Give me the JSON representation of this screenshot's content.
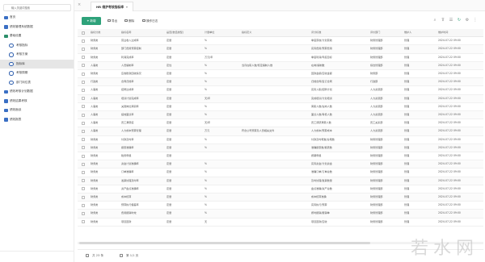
{
  "sidebar": {
    "search_placeholder": "输入关键词搜索",
    "items": [
      {
        "label": "首页",
        "level": 1,
        "icon": "home-icon"
      },
      {
        "label": "绩效管理系统数据",
        "level": 1,
        "icon": "chart-icon"
      },
      {
        "label": "基础设置",
        "level": 1,
        "icon": "folder-icon",
        "expanded": true
      },
      {
        "label": "考核指标",
        "level": 2,
        "icon": "circle-icon"
      },
      {
        "label": "考核方案",
        "level": 2,
        "icon": "circle-icon"
      },
      {
        "label": "指标库",
        "level": 2,
        "icon": "circle-icon",
        "active": true
      },
      {
        "label": "考核周期",
        "level": 2,
        "icon": "circle-icon"
      },
      {
        "label": "部门岗位表",
        "level": 2,
        "icon": "circle-icon"
      },
      {
        "label": "绩效考核计划数据",
        "level": 1,
        "icon": "list-icon"
      },
      {
        "label": "绩效结果考核",
        "level": 1,
        "icon": "list-icon"
      },
      {
        "label": "绩效面谈",
        "level": 1,
        "icon": "list-icon"
      },
      {
        "label": "绩效报表",
        "level": 1,
        "icon": "list-icon"
      }
    ]
  },
  "tab": {
    "title": "HR 维护考核指标库"
  },
  "toolbar": {
    "add_label": "新增",
    "export_label": "导出",
    "delete_label": "删除",
    "log_label": "操作日志"
  },
  "table": {
    "columns": [
      "指标分类",
      "指标名称",
      "是否(数值类型)",
      "计量单位",
      "指标定义",
      "评分标准",
      "评价部门",
      "维护人",
      "维护时间"
    ],
    "rows": [
      [
        "财务类",
        "营业收入达成率",
        "定量",
        "%",
        "",
        "季度营收/计划营收",
        "财务管理部",
        "管理",
        "2024-07-22 09:00"
      ],
      [
        "财务类",
        "部门费用预算控制",
        "定量",
        "%",
        "",
        "实际费用/预算费用",
        "财务管理部",
        "管理",
        "2024-07-22 09:00"
      ],
      [
        "财务类",
        "利润完成率",
        "定量",
        "万元/年",
        "",
        "季度利润/年度目标",
        "财务管理部",
        "管理",
        "2024-07-22 09:00"
      ],
      [
        "人事类",
        "人员编制率",
        "定性",
        "%",
        "当月在职人数/核定编制人数",
        "在岗/编制数",
        "综合管理部",
        "管理",
        "2024-07-22 09:00"
      ],
      [
        "财务类",
        "应收账款回收情况",
        "定量",
        "%",
        "",
        "回款金额/应收金额",
        "财务部",
        "管理",
        "2024-07-22 09:00"
      ],
      [
        "行政类",
        "合同归档率",
        "定量",
        "%",
        "",
        "归档合同/签订合同",
        "行政部",
        "管理",
        "2024-07-22 09:00"
      ],
      [
        "人事类",
        "招聘达成率",
        "定量",
        "%",
        "",
        "实际入职/招聘计划",
        "人力资源部",
        "管理",
        "2024-07-22 09:00"
      ],
      [
        "人事类",
        "培训计划完成率",
        "定量",
        "天/年",
        "",
        "完成培训/计划培训",
        "人力资源部",
        "管理",
        "2024-07-22 09:00"
      ],
      [
        "人事类",
        "关键岗位离职率",
        "定量",
        "%",
        "",
        "离职人数/在岗人数",
        "人力资源部",
        "管理",
        "2024-07-22 09:00"
      ],
      [
        "人事类",
        "绩效面谈率",
        "定量",
        "%",
        "",
        "面谈人数/考核人数",
        "人力资源部",
        "管理",
        "2024-07-22 09:00"
      ],
      [
        "人事类",
        "员工满意度",
        "定量",
        "天/年",
        "",
        "员工调研满意人数",
        "员工关系部",
        "管理",
        "2024-07-22 09:00"
      ],
      [
        "人事类",
        "人力成本预算管理",
        "定量",
        "万元",
        "符合公司预算及人员相关文件",
        "人力成本/预算成本",
        "人力资源部",
        "管理",
        "2024-07-22 09:00"
      ],
      [
        "财务类",
        "付款及时率",
        "定量",
        "%",
        "",
        "付款及时笔数/总笔数",
        "财务管理部",
        "管理",
        "2024-07-22 09:00"
      ],
      [
        "财务类",
        "报表准确率",
        "定量",
        "%",
        "",
        "准确报表数/报表数",
        "财务管理部",
        "管理",
        "2024-07-22 09:00"
      ],
      [
        "财务类",
        "税务申报",
        "定量",
        "",
        "",
        "按期申报",
        "财务管理部",
        "管理",
        "2024-07-22 09:00"
      ],
      [
        "财务类",
        "资金计划准确率",
        "定量",
        "%",
        "",
        "实际资金/计划资金",
        "财务管理部",
        "管理",
        "2024-07-22 09:00"
      ],
      [
        "财务类",
        "订单准确率",
        "定量",
        "%",
        "",
        "准确订单/订单总数",
        "财务管理部",
        "管理",
        "2024-07-22 09:00"
      ],
      [
        "财务类",
        "发票处理及时率",
        "定量",
        "%",
        "",
        "及时处理/发票数量",
        "财务管理部",
        "管理",
        "2024-07-22 09:00"
      ],
      [
        "财务类",
        "资产盘点准确率",
        "定量",
        "%",
        "",
        "盘点准确/资产总数",
        "财务管理部",
        "管理",
        "2024-07-22 09:00"
      ],
      [
        "财务类",
        "成本核算",
        "定量",
        "%",
        "",
        "成本核算准确",
        "财务管理部",
        "管理",
        "2024-07-22 09:00"
      ],
      [
        "财务类",
        "预算执行偏差率",
        "定量",
        "%",
        "",
        "实际执行/预算",
        "财务管理部",
        "管理",
        "2024-07-22 09:00"
      ],
      [
        "财务类",
        "费用报销时效",
        "定量",
        "%",
        "",
        "按时报销/报销单",
        "财务管理部",
        "管理",
        "2024-07-22 09:00"
      ],
      [
        "财务类",
        "项目回款",
        "定量",
        "天",
        "",
        "项目回款/应收",
        "财务管理部",
        "管理",
        "2024-07-22 09:00"
      ]
    ]
  },
  "footer": {
    "left_label": "共 23 条",
    "right_label": "第 1/1 页"
  },
  "watermark": "若水网",
  "colors": {
    "primary": "#2ea27a",
    "nav_icon": "#3a6fc4",
    "folder_icon": "#2c8f6a"
  }
}
